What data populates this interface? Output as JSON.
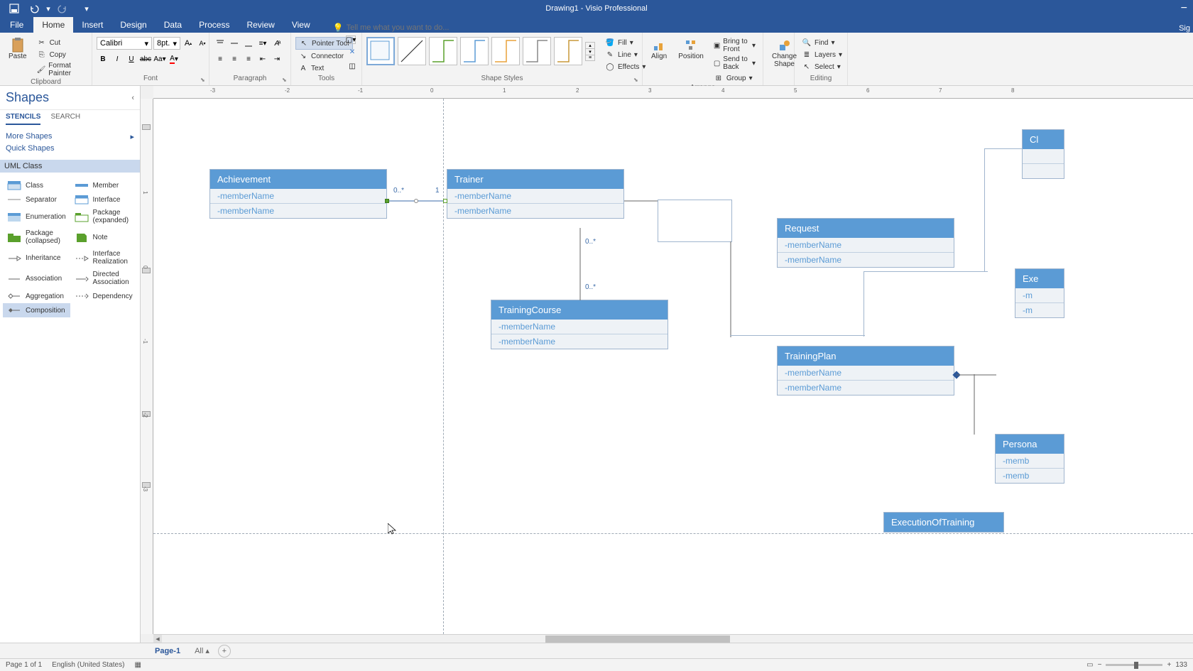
{
  "title": "Drawing1 - Visio Professional",
  "tabs": {
    "file": "File",
    "home": "Home",
    "insert": "Insert",
    "design": "Design",
    "data": "Data",
    "process": "Process",
    "review": "Review",
    "view": "View"
  },
  "tellme_placeholder": "Tell me what you want to do...",
  "sig": "Sig",
  "ribbon": {
    "clipboard": {
      "paste": "Paste",
      "cut": "Cut",
      "copy": "Copy",
      "format_painter": "Format Painter",
      "label": "Clipboard"
    },
    "font": {
      "name": "Calibri",
      "size": "8pt.",
      "label": "Font"
    },
    "paragraph": {
      "label": "Paragraph"
    },
    "tools": {
      "pointer": "Pointer Tool",
      "connector": "Connector",
      "text": "Text",
      "label": "Tools"
    },
    "shape_styles": {
      "fill": "Fill",
      "line": "Line",
      "effects": "Effects",
      "label": "Shape Styles"
    },
    "arrange": {
      "align": "Align",
      "position": "Position",
      "bring_front": "Bring to Front",
      "send_back": "Send to Back",
      "group": "Group",
      "label": "Arrange"
    },
    "change_shape": "Change\nShape",
    "editing": {
      "find": "Find",
      "layers": "Layers",
      "select": "Select",
      "label": "Editing"
    }
  },
  "shapes": {
    "title": "Shapes",
    "tabs": {
      "stencils": "STENCILS",
      "search": "SEARCH"
    },
    "more": "More Shapes",
    "quick": "Quick Shapes",
    "stencil": "UML Class",
    "items": [
      {
        "n": "Class"
      },
      {
        "n": "Member"
      },
      {
        "n": "Separator"
      },
      {
        "n": "Interface"
      },
      {
        "n": "Enumeration"
      },
      {
        "n": "Package (expanded)"
      },
      {
        "n": "Package (collapsed)"
      },
      {
        "n": "Note"
      },
      {
        "n": "Inheritance"
      },
      {
        "n": "Interface Realization"
      },
      {
        "n": "Association"
      },
      {
        "n": "Directed Association"
      },
      {
        "n": "Aggregation"
      },
      {
        "n": "Dependency"
      },
      {
        "n": "Composition"
      }
    ]
  },
  "canvas": {
    "ruler_h": [
      "-3",
      "-2",
      "-1",
      "0",
      "1",
      "2",
      "3",
      "4",
      "5",
      "6",
      "7",
      "8"
    ],
    "ruler_v": [
      "1",
      "0",
      "-1",
      "-2",
      "-3"
    ],
    "classes": {
      "achievement": {
        "title": "Achievement",
        "m1": "-memberName",
        "m2": "-memberName"
      },
      "trainer": {
        "title": "Trainer",
        "m1": "-memberName",
        "m2": "-memberName"
      },
      "request": {
        "title": "Request",
        "m1": "-memberName",
        "m2": "-memberName"
      },
      "trainingcourse": {
        "title": "TrainingCourse",
        "m1": "-memberName",
        "m2": "-memberName"
      },
      "trainingplan": {
        "title": "TrainingPlan",
        "m1": "-memberName",
        "m2": "-memberName"
      },
      "exe": {
        "title": "Exe",
        "m1": "-m",
        "m2": "-m"
      },
      "cl": {
        "title": "Cl"
      },
      "persona": {
        "title": "Persona",
        "m1": "-memb",
        "m2": "-memb"
      },
      "execution": {
        "title": "ExecutionOfTraining"
      }
    },
    "mult": {
      "zerostar": "0..*",
      "one": "1"
    }
  },
  "page": {
    "page1": "Page-1",
    "all": "All"
  },
  "status": {
    "page": "Page 1 of 1",
    "lang": "English (United States)",
    "zoom": "133"
  }
}
